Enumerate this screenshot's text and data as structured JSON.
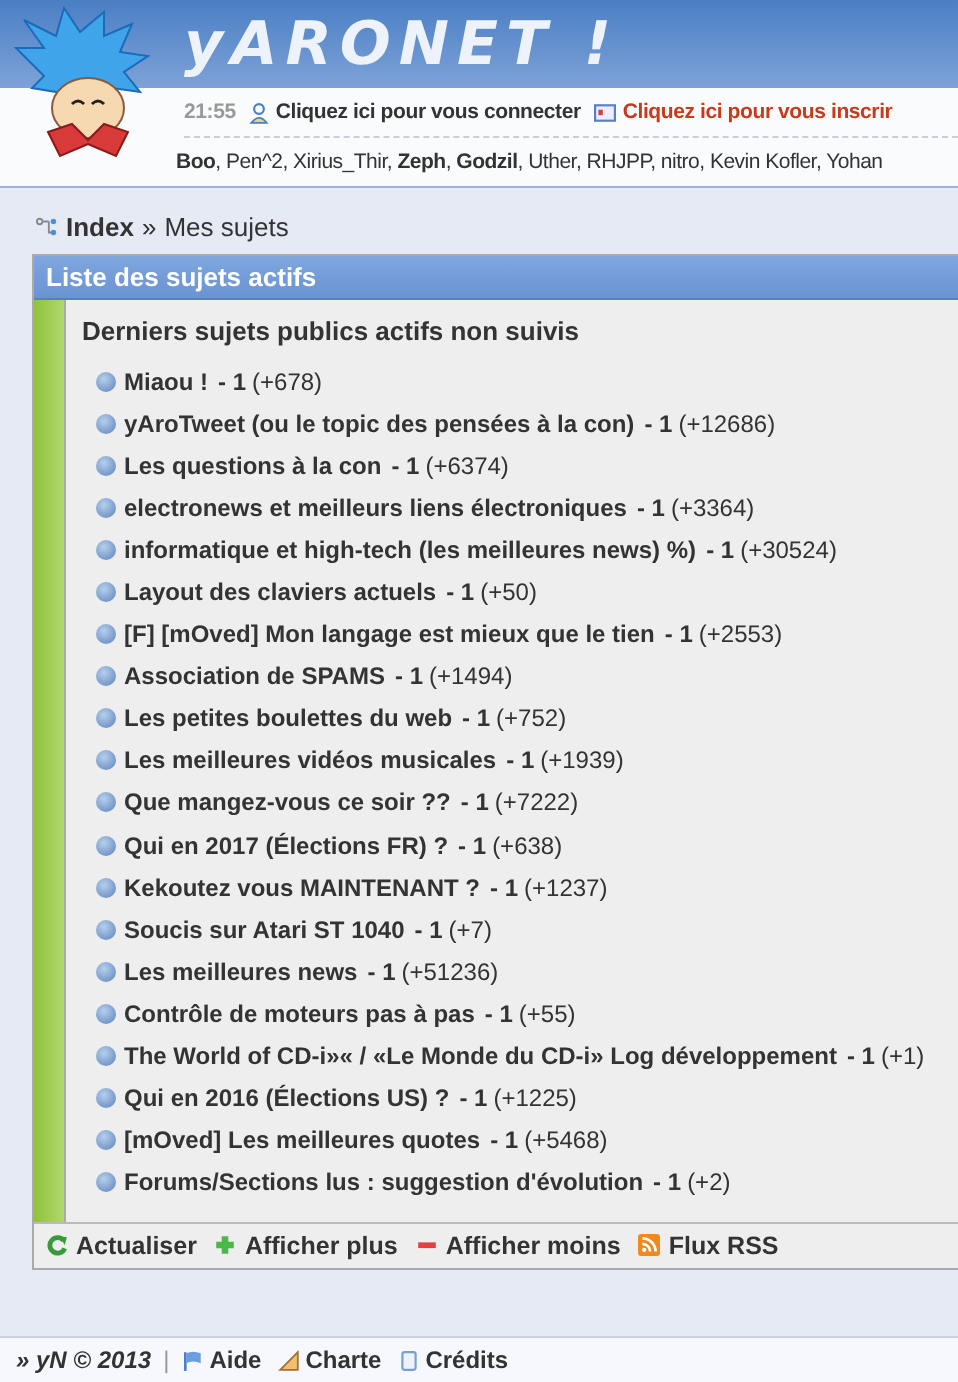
{
  "header": {
    "logo": "yARONET !",
    "time": "21:55",
    "login_link": "Cliquez ici pour vous connecter",
    "register_link": "Cliquez ici pour vous inscrir",
    "online_users": "**Boo**, Pen^2, Xirius_Thir, **Zeph**, **Godzil**, Uther, RHJPP, nitro, Kevin Kofler, Yohan"
  },
  "breadcrumb": {
    "home": "Index",
    "separator": "»",
    "current": "Mes sujets"
  },
  "panel": {
    "title": "Liste des sujets actifs",
    "section_title": "Derniers sujets publics actifs non suivis",
    "topics": [
      {
        "title": "Miaou !",
        "count": "- 1",
        "delta": "(+678)"
      },
      {
        "title": "yAroTweet (ou le topic des pensées à la con)",
        "count": "- 1",
        "delta": "(+12686)"
      },
      {
        "title": "Les questions à la con",
        "count": "- 1",
        "delta": "(+6374)"
      },
      {
        "title": "electronews et meilleurs liens électroniques",
        "count": "- 1",
        "delta": "(+3364)"
      },
      {
        "title": "informatique et high-tech (les meilleures news) %)",
        "count": "- 1",
        "delta": "(+30524)"
      },
      {
        "title": "Layout des claviers actuels",
        "count": "- 1",
        "delta": "(+50)"
      },
      {
        "title": "[F] [mOved] Mon langage est mieux que le tien",
        "count": "- 1",
        "delta": "(+2553)"
      },
      {
        "title": "Association de SPAMS",
        "count": "- 1",
        "delta": "(+1494)"
      },
      {
        "title": "Les petites boulettes du web",
        "count": "- 1",
        "delta": "(+752)"
      },
      {
        "title": "Les meilleures vidéos musicales",
        "count": "- 1",
        "delta": "(+1939)"
      },
      {
        "title": "Que mangez-vous ce soir ??",
        "count": "- 1",
        "delta": "(+7222)"
      },
      {
        "title": "Qui en 2017 (Élections FR) ?",
        "count": "- 1",
        "delta": "(+638)"
      },
      {
        "title": "Kekoutez vous MAINTENANT ?",
        "count": "- 1",
        "delta": "(+1237)"
      },
      {
        "title": "Soucis sur Atari ST 1040",
        "count": "- 1",
        "delta": "(+7)"
      },
      {
        "title": "Les meilleures news",
        "count": "- 1",
        "delta": "(+51236)"
      },
      {
        "title": "Contrôle de moteurs pas à pas",
        "count": "- 1",
        "delta": "(+55)"
      },
      {
        "title": "The World of CD-i»« / «Le Monde du CD-i» Log développement",
        "count": "- 1",
        "delta": "(+1)"
      },
      {
        "title": "Qui en 2016 (Élections US) ?",
        "count": "- 1",
        "delta": "(+1225)"
      },
      {
        "title": "[mOved] Les meilleures quotes",
        "count": "- 1",
        "delta": "(+5468)"
      },
      {
        "title": "Forums/Sections lus : suggestion d'évolution",
        "count": "- 1",
        "delta": "(+2)"
      }
    ],
    "actions": [
      {
        "kind": "refresh",
        "label": "Actualiser"
      },
      {
        "kind": "more",
        "label": "Afficher plus"
      },
      {
        "kind": "less",
        "label": "Afficher moins"
      },
      {
        "kind": "rss",
        "label": "Flux RSS"
      }
    ]
  },
  "footer": {
    "copyright": "» yN © 2013",
    "separator": "|",
    "links": [
      {
        "kind": "help",
        "label": "Aide"
      },
      {
        "kind": "charter",
        "label": "Charte"
      },
      {
        "kind": "credits",
        "label": "Crédits"
      }
    ]
  }
}
